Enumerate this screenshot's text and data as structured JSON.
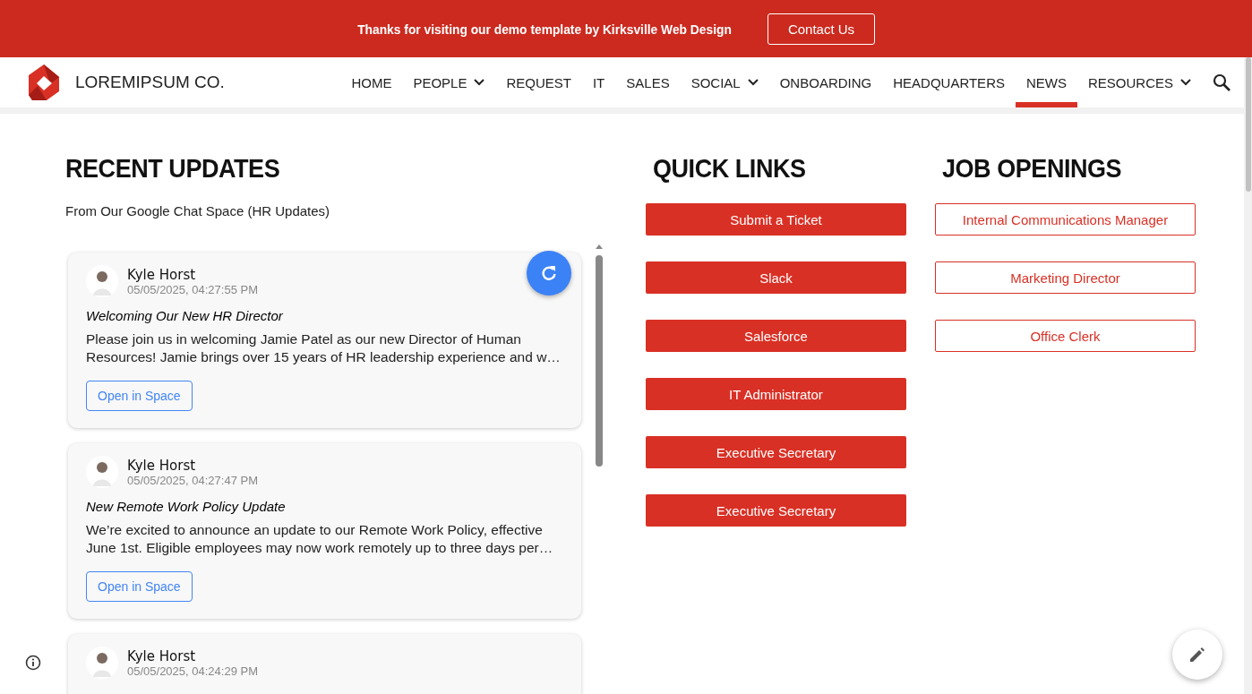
{
  "banner": {
    "text": "Thanks for visiting our demo template by Kirksville Web Design",
    "button": "Contact Us"
  },
  "header": {
    "brand": "LOREMIPSUM CO.",
    "nav": [
      {
        "label": "HOME",
        "dropdown": false,
        "selected": false
      },
      {
        "label": "PEOPLE",
        "dropdown": true,
        "selected": false
      },
      {
        "label": "REQUEST",
        "dropdown": false,
        "selected": false
      },
      {
        "label": "IT",
        "dropdown": false,
        "selected": false
      },
      {
        "label": "SALES",
        "dropdown": false,
        "selected": false
      },
      {
        "label": "SOCIAL",
        "dropdown": true,
        "selected": false
      },
      {
        "label": "ONBOARDING",
        "dropdown": false,
        "selected": false
      },
      {
        "label": "HEADQUARTERS",
        "dropdown": false,
        "selected": false
      },
      {
        "label": "NEWS",
        "dropdown": false,
        "selected": true
      },
      {
        "label": "RESOURCES",
        "dropdown": true,
        "selected": false
      }
    ]
  },
  "recent_updates": {
    "title": "RECENT UPDATES",
    "subtitle": "From Our Google Chat Space (HR Updates)",
    "posts": [
      {
        "author": "Kyle Horst",
        "time": "05/05/2025, 04:27:55 PM",
        "title": "Welcoming Our New HR Director",
        "body": "Please join us in welcoming Jamie Patel as our new Director of Human Resources! Jamie brings over 15 years of HR leadership experience and w…",
        "button": "Open in Space"
      },
      {
        "author": "Kyle Horst",
        "time": "05/05/2025, 04:27:47 PM",
        "title": "New Remote Work Policy Update",
        "body": "We’re excited to announce an update to our Remote Work Policy, effective June 1st. Eligible employees may now work remotely up to three days per…",
        "button": "Open in Space"
      },
      {
        "author": "Kyle Horst",
        "time": "05/05/2025, 04:24:29 PM"
      }
    ]
  },
  "quick_links": {
    "title": "QUICK LINKS",
    "links": [
      "Submit a Ticket",
      "Slack",
      "Salesforce",
      "IT Administrator",
      "Executive Secretary",
      "Executive Secretary"
    ]
  },
  "job_openings": {
    "title": "JOB OPENINGS",
    "links": [
      "Internal Communications Manager",
      "Marketing Director",
      "Office Clerk"
    ]
  }
}
